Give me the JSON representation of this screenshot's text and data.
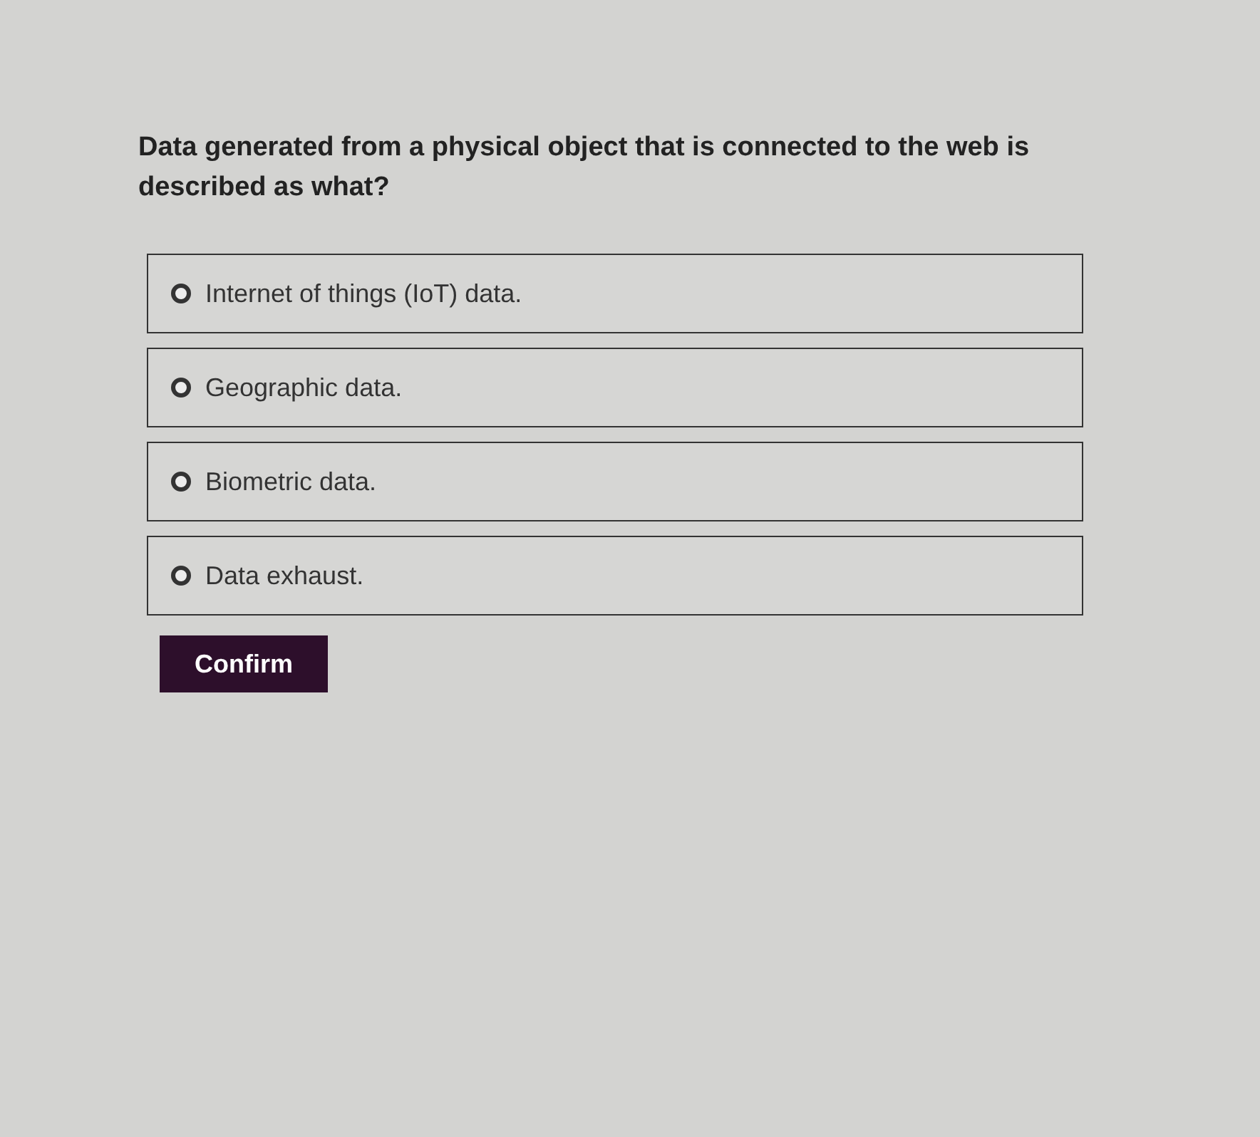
{
  "question": "Data generated from a physical object that is connected to the web is described as what?",
  "options": [
    {
      "label": "Internet of things (IoT) data.",
      "selected": false
    },
    {
      "label": "Geographic data.",
      "selected": false
    },
    {
      "label": "Biometric data.",
      "selected": false
    },
    {
      "label": "Data exhaust.",
      "selected": false
    }
  ],
  "confirm_button": "Confirm"
}
